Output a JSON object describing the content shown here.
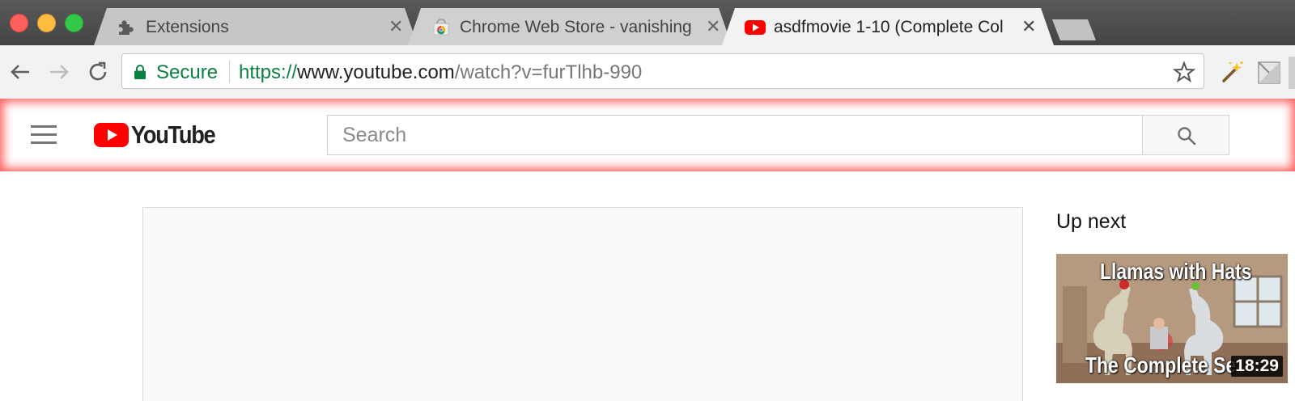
{
  "tabs": [
    {
      "title": "Extensions",
      "icon": "puzzle-icon",
      "active": false
    },
    {
      "title": "Chrome Web Store - vanishing",
      "icon": "chrome-web-store-icon",
      "active": false
    },
    {
      "title": "asdfmovie 1-10 (Complete Col",
      "icon": "youtube-favicon-icon",
      "active": true
    }
  ],
  "omnibox": {
    "security_label": "Secure",
    "url_scheme": "https://",
    "url_host": "www.youtube.com",
    "url_path": "/watch?v=furTlhb-990"
  },
  "masthead": {
    "logo_text": "YouTube",
    "search_placeholder": "Search"
  },
  "sidebar": {
    "heading": "Up next",
    "items": [
      {
        "thumb_title_top": "Llamas with Hats",
        "thumb_title_bottom": "The Complete Se",
        "duration": "18:29"
      }
    ]
  },
  "colors": {
    "youtube_red": "#ff0000",
    "secure_green": "#0b8043",
    "highlight_red": "#ff2828"
  }
}
